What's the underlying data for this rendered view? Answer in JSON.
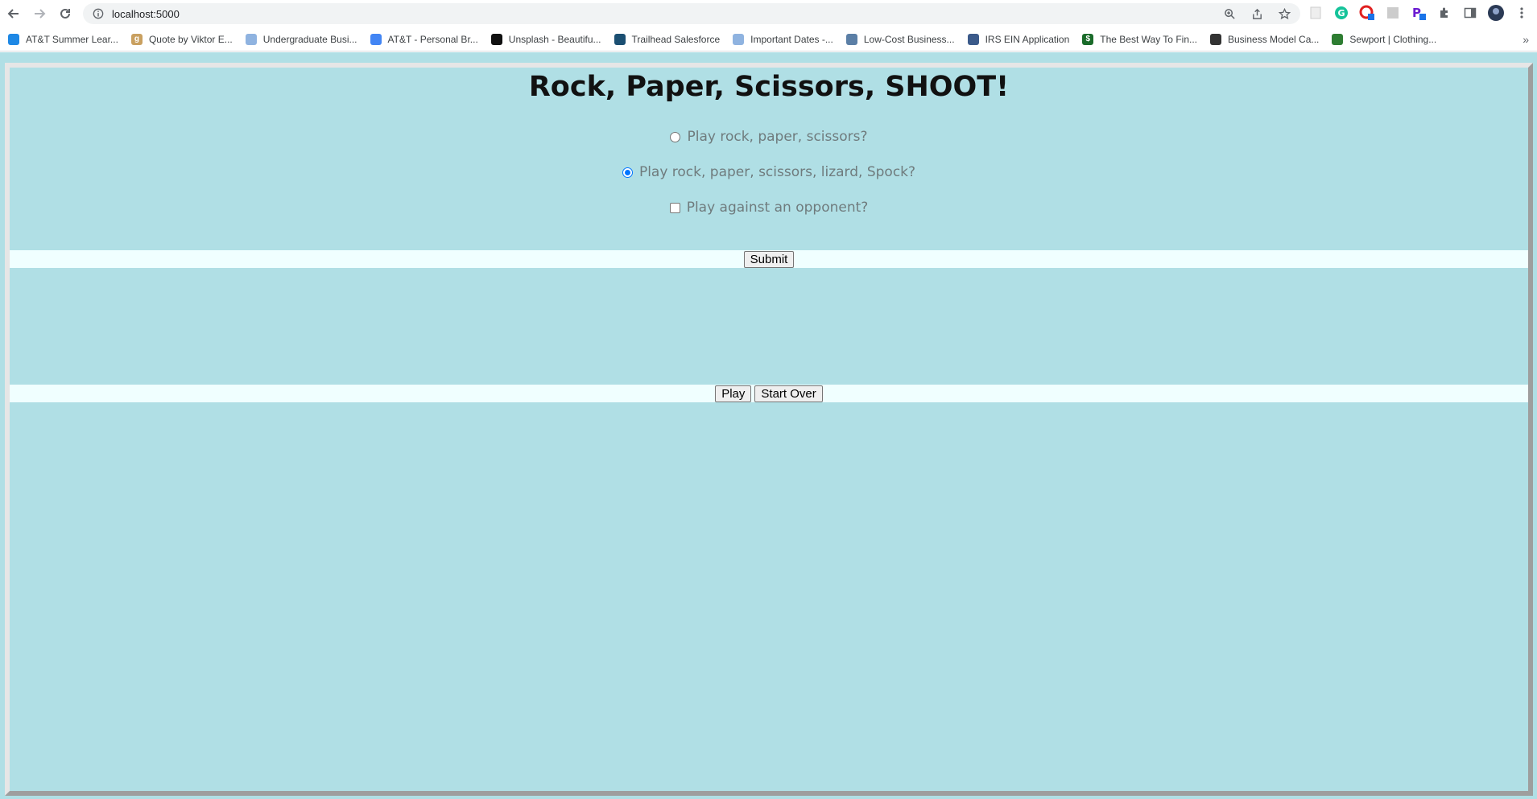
{
  "browser": {
    "url": "localhost:5000",
    "bookmarks": [
      {
        "label": "AT&T Summer Lear...",
        "color": "#1e88e5",
        "glyph": ""
      },
      {
        "label": "Quote by Viktor E...",
        "color": "#c9a060",
        "glyph": "g"
      },
      {
        "label": "Undergraduate Busi...",
        "color": "#8fb3e0",
        "glyph": ""
      },
      {
        "label": "AT&T - Personal Br...",
        "color": "#4285f4",
        "glyph": ""
      },
      {
        "label": "Unsplash - Beautifu...",
        "color": "#111111",
        "glyph": ""
      },
      {
        "label": "Trailhead Salesforce",
        "color": "#1b4f72",
        "glyph": ""
      },
      {
        "label": "Important Dates -...",
        "color": "#8fb3e0",
        "glyph": ""
      },
      {
        "label": "Low-Cost Business...",
        "color": "#5b7fa6",
        "glyph": ""
      },
      {
        "label": "IRS EIN Application",
        "color": "#3b5a8a",
        "glyph": ""
      },
      {
        "label": "The Best Way To Fin...",
        "color": "#1a6b2a",
        "glyph": "$"
      },
      {
        "label": "Business Model Ca...",
        "color": "#333333",
        "glyph": ""
      },
      {
        "label": "Sewport | Clothing...",
        "color": "#2e7d32",
        "glyph": ""
      }
    ]
  },
  "page": {
    "title": "Rock, Paper, Scissors, SHOOT!",
    "options": {
      "rps": "Play rock, paper, scissors?",
      "rpsls": "Play rock, paper, scissors, lizard, Spock?",
      "opponent": "Play against an opponent?"
    },
    "submit_label": "Submit",
    "play_label": "Play",
    "start_over_label": "Start Over"
  },
  "colors": {
    "background": "#b0dfe5",
    "band": "#f0ffff",
    "accent": "#0075ff"
  }
}
